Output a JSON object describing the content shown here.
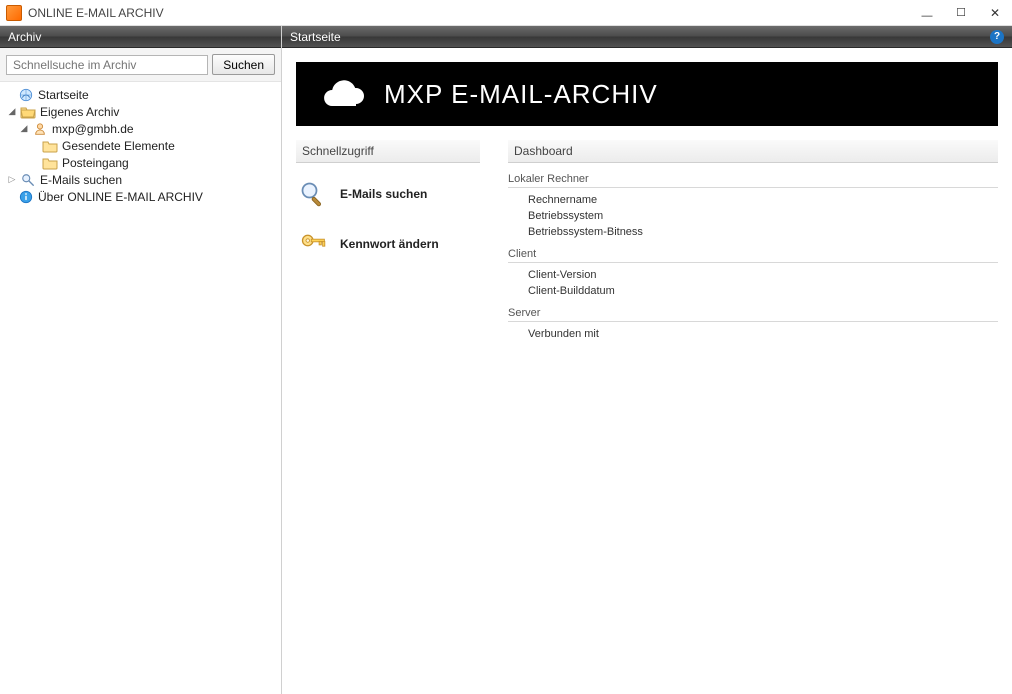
{
  "window": {
    "title": "ONLINE E-MAIL ARCHIV"
  },
  "sidebar": {
    "heading": "Archiv",
    "search_placeholder": "Schnellsuche im Archiv",
    "search_button": "Suchen",
    "tree": {
      "start": "Startseite",
      "own_archive": "Eigenes Archiv",
      "account": "mxp@gmbh.de",
      "sent": "Gesendete Elemente",
      "inbox": "Posteingang",
      "search_mails": "E-Mails suchen",
      "about": "Über ONLINE E-MAIL ARCHIV"
    }
  },
  "main": {
    "heading": "Startseite",
    "banner_title": "MXP E-MAIL-ARCHIV",
    "quick_heading": "Schnellzugriff",
    "quick": {
      "search": "E-Mails suchen",
      "password": "Kennwort ändern"
    },
    "dashboard_heading": "Dashboard",
    "groups": {
      "local": {
        "title": "Lokaler Rechner",
        "computer_name": "Rechnername",
        "os": "Betriebssystem",
        "os_bitness": "Betriebssystem-Bitness"
      },
      "client": {
        "title": "Client",
        "version": "Client-Version",
        "build_date": "Client-Builddatum"
      },
      "server": {
        "title": "Server",
        "connected": "Verbunden mit"
      }
    }
  }
}
